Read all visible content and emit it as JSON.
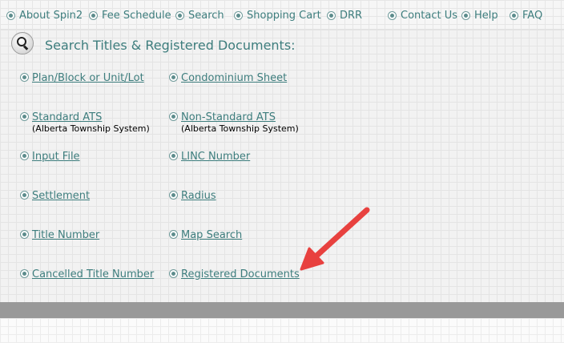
{
  "nav": {
    "items": [
      {
        "label": "About Spin2"
      },
      {
        "label": "Fee Schedule"
      },
      {
        "label": "Search"
      },
      {
        "label": "Shopping Cart"
      },
      {
        "label": "DRR"
      },
      {
        "label": "Contact Us"
      },
      {
        "label": "Help"
      },
      {
        "label": "FAQ"
      }
    ]
  },
  "main": {
    "heading": "Search Titles & Registered Documents:",
    "icon": "magnifier-icon",
    "links": {
      "plan_block": "Plan/Block or Unit/Lot",
      "condo_sheet": "Condominium Sheet",
      "standard_ats": "Standard ATS",
      "standard_ats_sub": "(Alberta Township System)",
      "nonstandard_ats": "Non-Standard ATS",
      "nonstandard_ats_sub": "(Alberta Township System)",
      "input_file": "Input File",
      "linc_number": "LINC Number",
      "settlement": "Settlement",
      "radius": "Radius",
      "title_number": "Title Number",
      "map_search": "Map Search",
      "cancelled_title": "Cancelled Title Number",
      "registered_docs": "Registered Documents"
    }
  },
  "colors": {
    "link": "#3d7d7d",
    "annotation_arrow": "#e8413f",
    "footer_bar": "#999999"
  }
}
